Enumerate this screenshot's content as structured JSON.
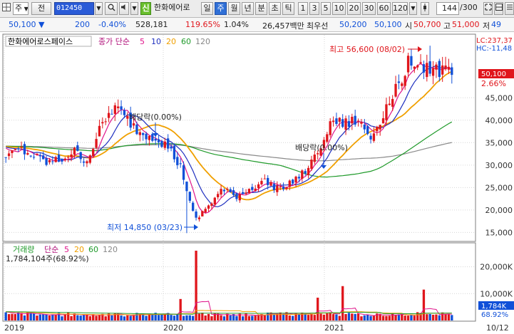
{
  "toolbar": {
    "market": "주",
    "jeon": "전",
    "code": "012450",
    "sin": "신",
    "stock_name": "한화에어로",
    "periods": [
      "일",
      "주",
      "월",
      "년",
      "분",
      "초",
      "틱"
    ],
    "selected_period": "주",
    "intervals": [
      "1",
      "3",
      "5",
      "10",
      "20",
      "30",
      "60",
      "120"
    ],
    "count": "144",
    "count_total": "/300"
  },
  "quote": {
    "price": "50,100",
    "change": "200",
    "change_pct": "-0.40%",
    "volume": "528,181",
    "vol_ratio": "119.65%",
    "turnover_pct": "1.04%",
    "amount": "26,457백만",
    "pref_label": "최우선",
    "ask": "50,200",
    "bid": "50,100",
    "open_label": "시",
    "open": "50,700",
    "high_label": "고",
    "high": "51,000",
    "low_label": "저",
    "low": "49"
  },
  "price_panel": {
    "title": "한화에어로스페이스",
    "ma_label": "종가 단순",
    "ma_periods": [
      "5",
      "10",
      "20",
      "60",
      "120"
    ],
    "lc_text": "LC:237,37",
    "hc_text": "HC:-11,48",
    "current_price_tag": "50,100",
    "current_pct_tag": "2.66%",
    "annotations": {
      "high": "최고 56,600 (08/02)",
      "low": "최저 14,850 (03/23)",
      "div1": "배당락(0.00%)",
      "div2": "배당락(0.00%)"
    }
  },
  "volume_panel": {
    "title": "거래량",
    "ma_label": "단순",
    "ma_periods": [
      "5",
      "20",
      "60",
      "120"
    ],
    "value_text": "1,784,104주(68.92%)",
    "tag_value": "1,784K",
    "tag_pct": "68.92%"
  },
  "colors": {
    "up": "#e0161c",
    "down": "#1050d8",
    "ma5": "#e0168c",
    "ma10": "#1e2fbf",
    "ma20": "#f0a000",
    "ma60": "#1f9a2a",
    "ma120": "#8a8a8a",
    "accent": "#2f6fd6"
  },
  "chart_data": {
    "type": "candlestick",
    "title": "한화에어로스페이스",
    "x": [
      "2019-01",
      "2019-02",
      "2019-03",
      "2019-04",
      "2019-05",
      "2019-06",
      "2019-07",
      "2019-08",
      "2019-09",
      "2019-10",
      "2019-11",
      "2019-12",
      "2020-01",
      "2020-02",
      "2020-03",
      "2020-04",
      "2020-05",
      "2020-06",
      "2020-07",
      "2020-08",
      "2020-09",
      "2020-10",
      "2020-11",
      "2020-12",
      "2021-01",
      "2021-02",
      "2021-03",
      "2021-04",
      "2021-05",
      "2021-06",
      "2021-07",
      "2021-08",
      "2021-09",
      "2021-10"
    ],
    "price_close": [
      31500,
      33500,
      32000,
      30500,
      31000,
      33000,
      31000,
      38000,
      43000,
      40000,
      37000,
      36500,
      34000,
      29000,
      17500,
      21000,
      24500,
      23000,
      24500,
      26500,
      25000,
      26000,
      28000,
      32000,
      40000,
      39000,
      40000,
      36000,
      42000,
      48000,
      54000,
      52000,
      51000,
      50100
    ],
    "x_ticks": [
      "2019",
      "2020",
      "2021",
      "10/12"
    ],
    "y_ticks": [
      15000,
      20000,
      25000,
      30000,
      35000,
      40000,
      45000
    ],
    "ylim": [
      13000,
      59000
    ],
    "volume_ticks": [
      "10,000K",
      "20,000K"
    ],
    "volume_ylim": [
      0,
      26000
    ],
    "volume_spikes_k": [
      {
        "period": "2020-02",
        "value": 8000
      },
      {
        "period": "2020-03",
        "value": 26000
      },
      {
        "period": "2020-12",
        "value": 8500
      },
      {
        "period": "2021-02",
        "value": 12800
      },
      {
        "period": "2021-08",
        "value": 11500
      }
    ],
    "high": {
      "value": 56600,
      "date": "08/02"
    },
    "low": {
      "value": 14850,
      "date": "03/23"
    },
    "last": 50100
  }
}
